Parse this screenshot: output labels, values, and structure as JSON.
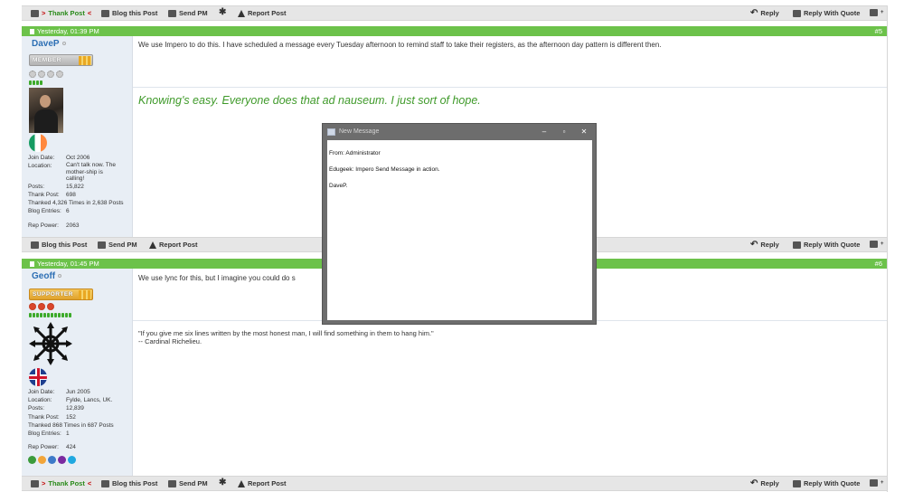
{
  "toolbar_top": {
    "thank_prefix": ">",
    "thank": "Thank Post",
    "thank_suffix": "<",
    "blog": "Blog this Post",
    "pm": "Send PM",
    "report": "Report Post",
    "reply": "Reply",
    "reply_quote": "Reply With Quote"
  },
  "post5": {
    "date": "Yesterday, 01:39 PM",
    "number": "#5",
    "username": "DaveP",
    "rank": "MEMBER",
    "message": "We use Impero to do this. I have scheduled a message every Tuesday afternoon to remind staff to take their registers, as the afternoon day pattern is different then.",
    "signature": "Knowing's easy. Everyone does that ad nauseum. I just sort of hope.",
    "info": {
      "join_label": "Join Date:",
      "join": "Oct 2006",
      "location_label": "Location:",
      "location": "Can't talk now. The mother-ship is calling!",
      "posts_label": "Posts:",
      "posts": "15,822",
      "thank_label": "Thank Post:",
      "thank": "698",
      "thanked": "Thanked 4,326 Times in 2,638 Posts",
      "blog_label": "Blog Entries:",
      "blog": "6",
      "rep_label": "Rep Power:",
      "rep": "2063"
    },
    "toolbar": {
      "blog": "Blog this Post",
      "pm": "Send PM",
      "report": "Report Post",
      "reply": "Reply",
      "reply_quote": "Reply With Quote"
    }
  },
  "post6": {
    "date": "Yesterday, 01:45 PM",
    "number": "#6",
    "username": "Geoff",
    "rank": "SUPPORTER",
    "message": "We use lync for this, but I imagine you could do s",
    "signature_line1": "\"If you give me six lines written by the most honest man, I will find something in them to hang him.\"",
    "signature_line2": "-- Cardinal Richelieu.",
    "info": {
      "join_label": "Join Date:",
      "join": "Jun 2005",
      "location_label": "Location:",
      "location": "Fylde, Lancs, UK.",
      "posts_label": "Posts:",
      "posts": "12,839",
      "thank_label": "Thank Post:",
      "thank": "152",
      "thanked": "Thanked 868 Times in 687 Posts",
      "blog_label": "Blog Entries:",
      "blog": "1",
      "rep_label": "Rep Power:",
      "rep": "424"
    },
    "toolbar": {
      "thank_prefix": ">",
      "thank": "Thank Post",
      "thank_suffix": "<",
      "blog": "Blog this Post",
      "pm": "Send PM",
      "report": "Report Post",
      "reply": "Reply",
      "reply_quote": "Reply With Quote"
    }
  },
  "dialog": {
    "title": "New Message",
    "from": "From: Administrator",
    "body": "Edugeek: Impero Send Message in action.",
    "signoff": "DaveP."
  },
  "colors": {
    "header_green": "#6cc24a",
    "username_blue": "#2d6fb4",
    "signature_green": "#3f9a2a",
    "thank_green": "#2a8a1a"
  }
}
